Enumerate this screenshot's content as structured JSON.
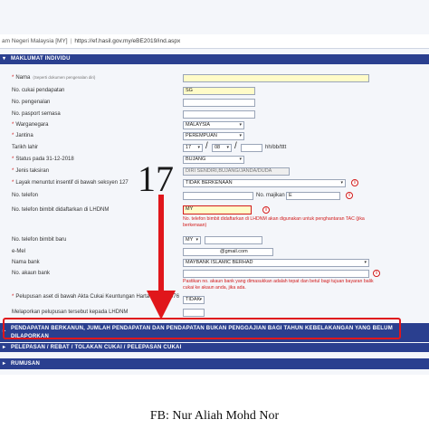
{
  "browser": {
    "site_fragment": "am Negeri Malaysia [MY]",
    "separator": "|",
    "url": "https://ef.hasil.gov.my/eBE2019/ind.aspx"
  },
  "sections": {
    "individu": "MAKLUMAT INDIVIDU",
    "pendapatan": "PENDAPATAN BERKANUN, JUMLAH PENDAPATAN DAN PENDAPATAN BUKAN PENGGAJIAN BAGI TAHUN KEBELAKANGAN YANG BELUM DILAPORKAN",
    "pelepasan": "PELEPASAN / REBAT / TOLAKAN CUKAI / PELEPASAN CUKAI",
    "rumusan": "RUMUSAN"
  },
  "form": {
    "nama_label": "Nama",
    "nama_note": "(Seperti dokumen pengenalan diri)",
    "nama_value": "",
    "cukai_label": "No. cukai pendapatan",
    "cukai_prefix": "SG",
    "pengenalan_label": "No. pengenalan",
    "pasport_label": "No. pasport semasa",
    "warganegara_label": "Warganegara",
    "warganegara_value": "MALAYSIA",
    "jantina_label": "Jantina",
    "jantina_value": "PEREMPUAN",
    "tarikh_label": "Tarikh lahir",
    "tarikh_day": "17",
    "tarikh_month": "08",
    "tarikh_sep": "/",
    "tarikh_hint": "hh/bb/tttt",
    "status_label": "Status pada 31-12-2018",
    "status_value": "BUJANG",
    "taksiran_label": "Jenis taksiran",
    "taksiran_value": "DIRI SENDIRI,BUJANG/JANDA/DUDA",
    "layak_label": "Layak menuntut insentif di bawah seksyen 127",
    "layak_value": "TIDAK BERKENAAN",
    "telefon_label": "No. telefon",
    "majikan_label": "No. majikan",
    "majikan_prefix": "E",
    "bimbit_lhdnm_label": "No. telefon bimbit didaftarkan di LHDNM",
    "bimbit_lhdnm_prefix": "MY",
    "bimbit_note": "No. telefon bimbit didaftarkan di LHDNM akan digunakan untuk penghantaran TAC (jika berkenaan)",
    "bimbit_baru_label": "No. telefon bimbit baru",
    "bimbit_baru_prefix": "MY",
    "email_label": "e-Mel",
    "email_value": "@gmail.com",
    "bank_label": "Nama bank",
    "bank_value": "MAYBANK ISLAMIC BERHAD",
    "akaun_label": "No. akaun bank",
    "akaun_note": "Pastikan no. akaun bank yang dimasukkan adalah tepat dan betul bagi tujuan bayaran balik cukai ke akaun anda, jika ada.",
    "pelupusan_label": "Pelupusan aset di bawah Akta Cukai Keuntungan Harta Tanah 1976",
    "pelupusan_value": "TIDAK",
    "melaporkan_label": "Melaporkan pelupusan tersebut kepada LHDNM"
  },
  "annotation": {
    "step_number": "17"
  },
  "caption": "FB: Nur Aliah Mohd Nor",
  "icons": {
    "expand": "chevron-down-icon",
    "collapsed": "chevron-right-icon",
    "info": "info-icon",
    "arrow": "down-arrow-icon"
  },
  "colors": {
    "section_bar": "#2a3f8f",
    "highlight": "#e0161b",
    "required_field": "#fffbc8",
    "warning_text": "#d21b1b"
  }
}
